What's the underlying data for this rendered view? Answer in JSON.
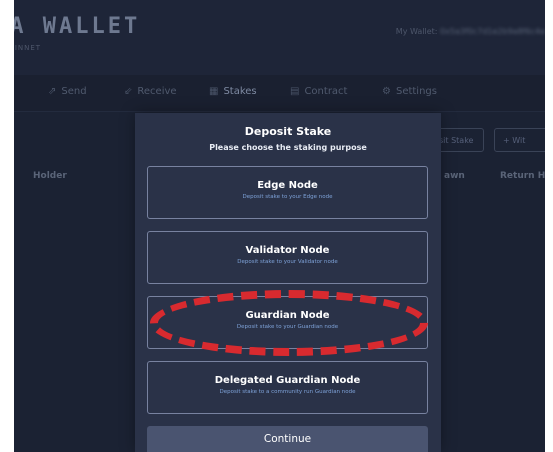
{
  "brand": {
    "title": "TA WALLET",
    "subtitle": "MAINNET"
  },
  "header": {
    "address_label": "My Wallet:",
    "address_value": "0x5a3f0c7d1e2b9a8f6c4e"
  },
  "nav": {
    "items": [
      {
        "label": "Send",
        "icon": "send-icon"
      },
      {
        "label": "Receive",
        "icon": "receive-icon"
      },
      {
        "label": "Stakes",
        "icon": "stakes-icon"
      },
      {
        "label": "Contract",
        "icon": "contract-icon"
      },
      {
        "label": "Settings",
        "icon": "settings-icon"
      }
    ],
    "active": "Stakes"
  },
  "stakes_page": {
    "deposit_button": "sit Stake",
    "withdraw_button": "+ Wit",
    "columns": [
      "Holder",
      "awn",
      "Return H"
    ]
  },
  "modal": {
    "title": "Deposit Stake",
    "subtitle": "Please choose the staking purpose",
    "options": [
      {
        "title": "Edge Node",
        "description": "Deposit stake to your Edge node"
      },
      {
        "title": "Validator Node",
        "description": "Deposit stake to your Validator node"
      },
      {
        "title": "Guardian Node",
        "description": "Deposit stake to your Guardian node"
      },
      {
        "title": "Delegated Guardian Node",
        "description": "Deposit stake to a community run Guardian node"
      }
    ],
    "continue_label": "Continue"
  },
  "colors": {
    "background": "#1b2233",
    "modal": "#2a3248",
    "option_border": "#7882a0",
    "option_description": "#7ea2d8",
    "continue_button": "#4a5470",
    "highlight": "#d82a2f"
  }
}
